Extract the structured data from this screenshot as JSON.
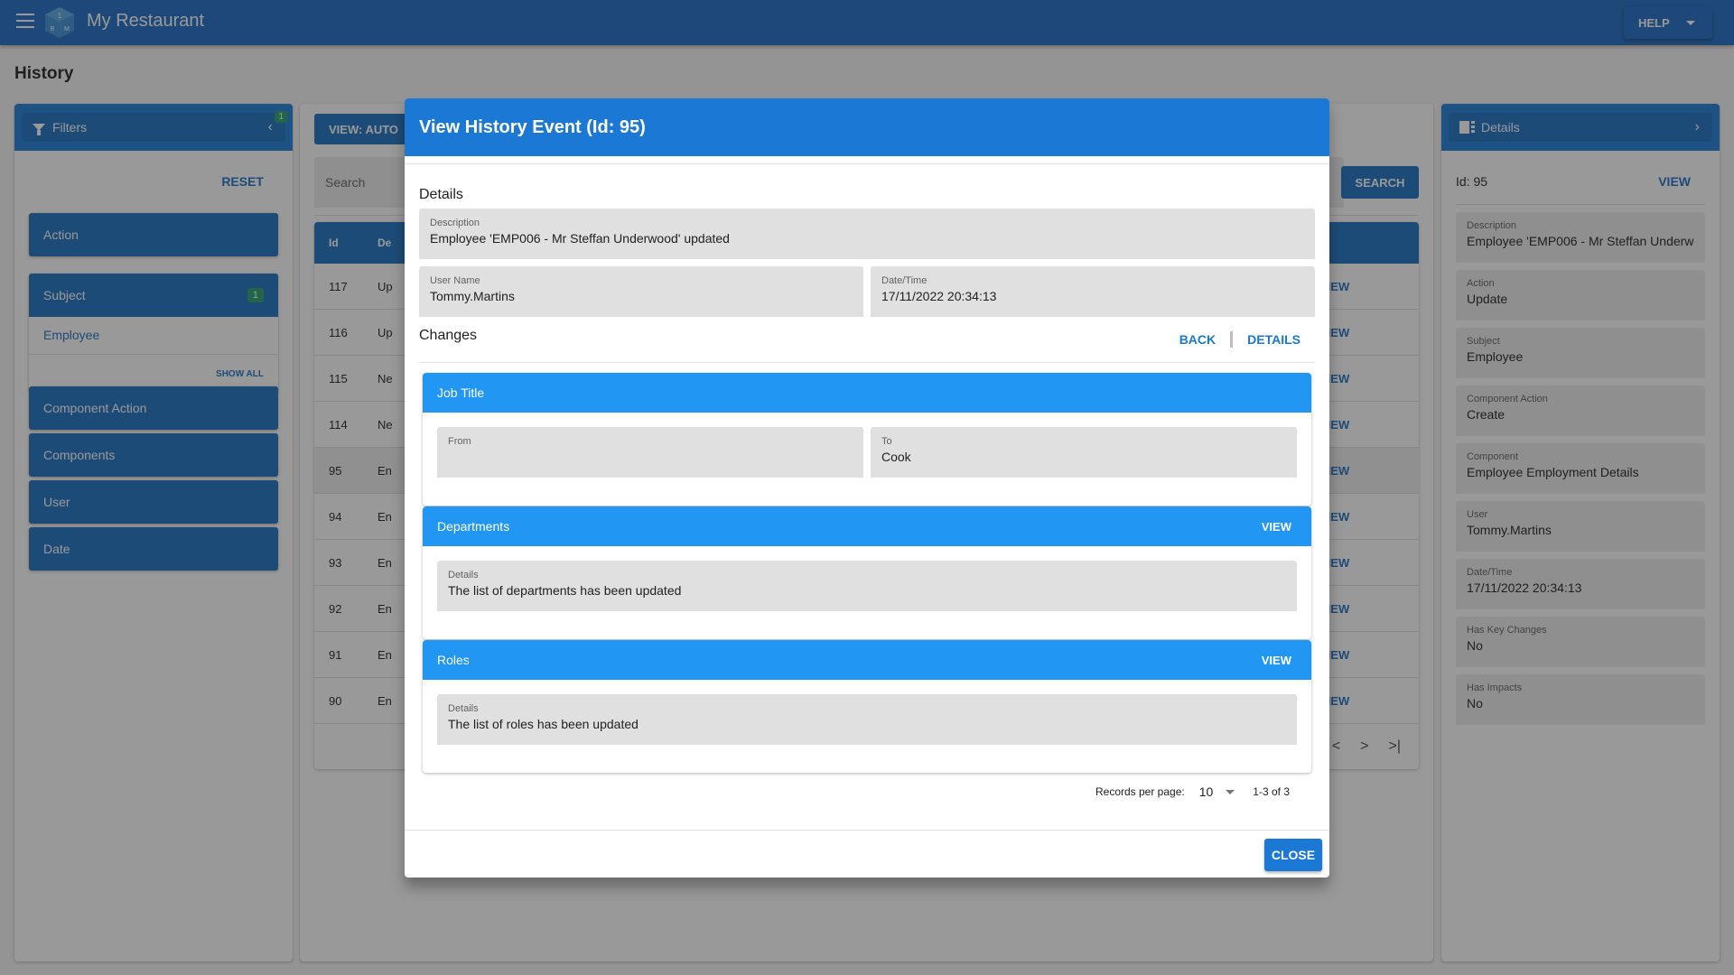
{
  "app": {
    "title": "My Restaurant",
    "help_label": "HELP",
    "logo_letters": [
      "1",
      "B",
      "M"
    ]
  },
  "page": {
    "title": "History"
  },
  "filters": {
    "title": "Filters",
    "badge": "1",
    "reset_label": "RESET",
    "groups": [
      {
        "label": "Action"
      },
      {
        "label": "Subject",
        "badge": "1",
        "items": [
          "Employee"
        ],
        "show_all_label": "SHOW ALL"
      },
      {
        "label": "Component Action"
      },
      {
        "label": "Components"
      },
      {
        "label": "User"
      },
      {
        "label": "Date"
      }
    ]
  },
  "center": {
    "view_mode_label": "VIEW: AUTO",
    "search_placeholder": "Search",
    "search_button": "SEARCH",
    "columns": {
      "id": "Id",
      "description": "De"
    },
    "rows": [
      {
        "id": "117",
        "desc": "Up",
        "view": "VIEW"
      },
      {
        "id": "116",
        "desc": "Up",
        "view": "VIEW"
      },
      {
        "id": "115",
        "desc": "Ne",
        "view": "VIEW"
      },
      {
        "id": "114",
        "desc": "Ne",
        "view": "VIEW"
      },
      {
        "id": "95",
        "desc": "En",
        "view": "VIEW",
        "selected": true
      },
      {
        "id": "94",
        "desc": "En",
        "view": "VIEW"
      },
      {
        "id": "93",
        "desc": "En",
        "view": "VIEW"
      },
      {
        "id": "92",
        "desc": "En",
        "view": "VIEW"
      },
      {
        "id": "91",
        "desc": "En",
        "view": "VIEW"
      },
      {
        "id": "90",
        "desc": "En",
        "view": "VIEW"
      }
    ],
    "pager": {
      "prev": "<",
      "next": ">",
      "last": ">|"
    }
  },
  "details_panel": {
    "title": "Details",
    "id_line": "Id: 95",
    "view_label": "VIEW",
    "fields": [
      {
        "label": "Description",
        "value": "Employee 'EMP006 - Mr Steffan Underw"
      },
      {
        "label": "Action",
        "value": "Update"
      },
      {
        "label": "Subject",
        "value": "Employee"
      },
      {
        "label": "Component Action",
        "value": "Create"
      },
      {
        "label": "Component",
        "value": "Employee Employment Details"
      },
      {
        "label": "User",
        "value": "Tommy.Martins"
      },
      {
        "label": "Date/Time",
        "value": "17/11/2022 20:34:13"
      },
      {
        "label": "Has Key Changes",
        "value": "No"
      },
      {
        "label": "Has Impacts",
        "value": "No"
      }
    ]
  },
  "dialog": {
    "title": "View History Event (Id: 95)",
    "details_heading": "Details",
    "description": {
      "label": "Description",
      "value": "Employee 'EMP006 - Mr Steffan Underwood' updated"
    },
    "user_name": {
      "label": "User Name",
      "value": "Tommy.Martins"
    },
    "date_time": {
      "label": "Date/Time",
      "value": "17/11/2022 20:34:13"
    },
    "changes_heading": "Changes",
    "back_label": "BACK",
    "details_label": "DETAILS",
    "changes": [
      {
        "title": "Job Title",
        "from_label": "From",
        "from_value": "",
        "to_label": "To",
        "to_value": "Cook"
      },
      {
        "title": "Departments",
        "view_label": "VIEW",
        "detail_label": "Details",
        "detail_value": "The list of departments has been updated"
      },
      {
        "title": "Roles",
        "view_label": "VIEW",
        "detail_label": "Details",
        "detail_value": "The list of roles has been updated"
      }
    ],
    "records_per_page_label": "Records per page:",
    "records_per_page_value": "10",
    "range_label": "1-3 of 3",
    "close_label": "CLOSE"
  },
  "colors": {
    "primary": "#1b6fc2",
    "dialog_header": "#1b78d4",
    "card_header": "#2196f3",
    "badge": "#26a069"
  }
}
